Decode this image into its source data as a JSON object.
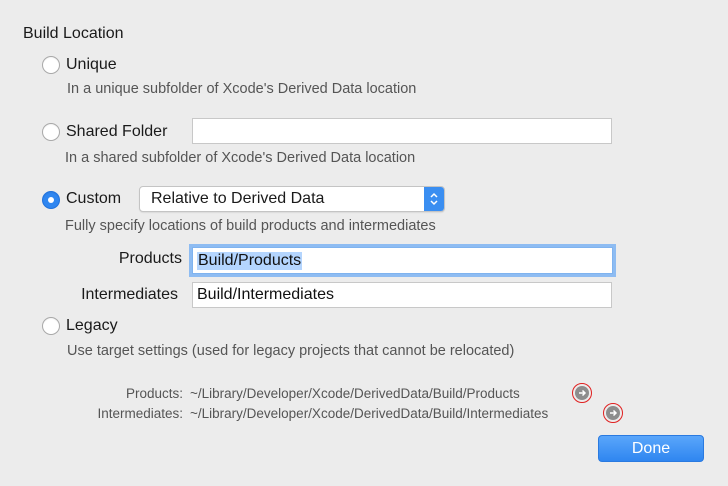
{
  "section_title": "Build Location",
  "options": {
    "unique": {
      "label": "Unique",
      "description": "In a unique subfolder of Xcode's Derived Data location",
      "selected": false
    },
    "shared": {
      "label": "Shared Folder",
      "description": "In a shared subfolder of Xcode's Derived Data location",
      "field_value": "",
      "selected": false
    },
    "custom": {
      "label": "Custom",
      "description": "Fully specify locations of build products and intermediates",
      "popup_value": "Relative to Derived Data",
      "selected": true,
      "products_label": "Products",
      "products_value": "Build/Products",
      "intermediates_label": "Intermediates",
      "intermediates_value": "Build/Intermediates"
    },
    "legacy": {
      "label": "Legacy",
      "description": "Use target settings (used for legacy projects that cannot be relocated)",
      "selected": false
    }
  },
  "resolved_paths": {
    "products_label": "Products:",
    "products_path": "~/Library/Developer/Xcode/DerivedData/Build/Products",
    "intermediates_label": "Intermediates:",
    "intermediates_path": "~/Library/Developer/Xcode/DerivedData/Build/Intermediates"
  },
  "done_button": "Done",
  "colors": {
    "accent": "#2f86f0",
    "highlight_ring": "#e02020",
    "background": "#ececec"
  },
  "icons": {
    "reveal": "arrow-right-circle-icon",
    "popup": "updown-chevron-icon"
  }
}
